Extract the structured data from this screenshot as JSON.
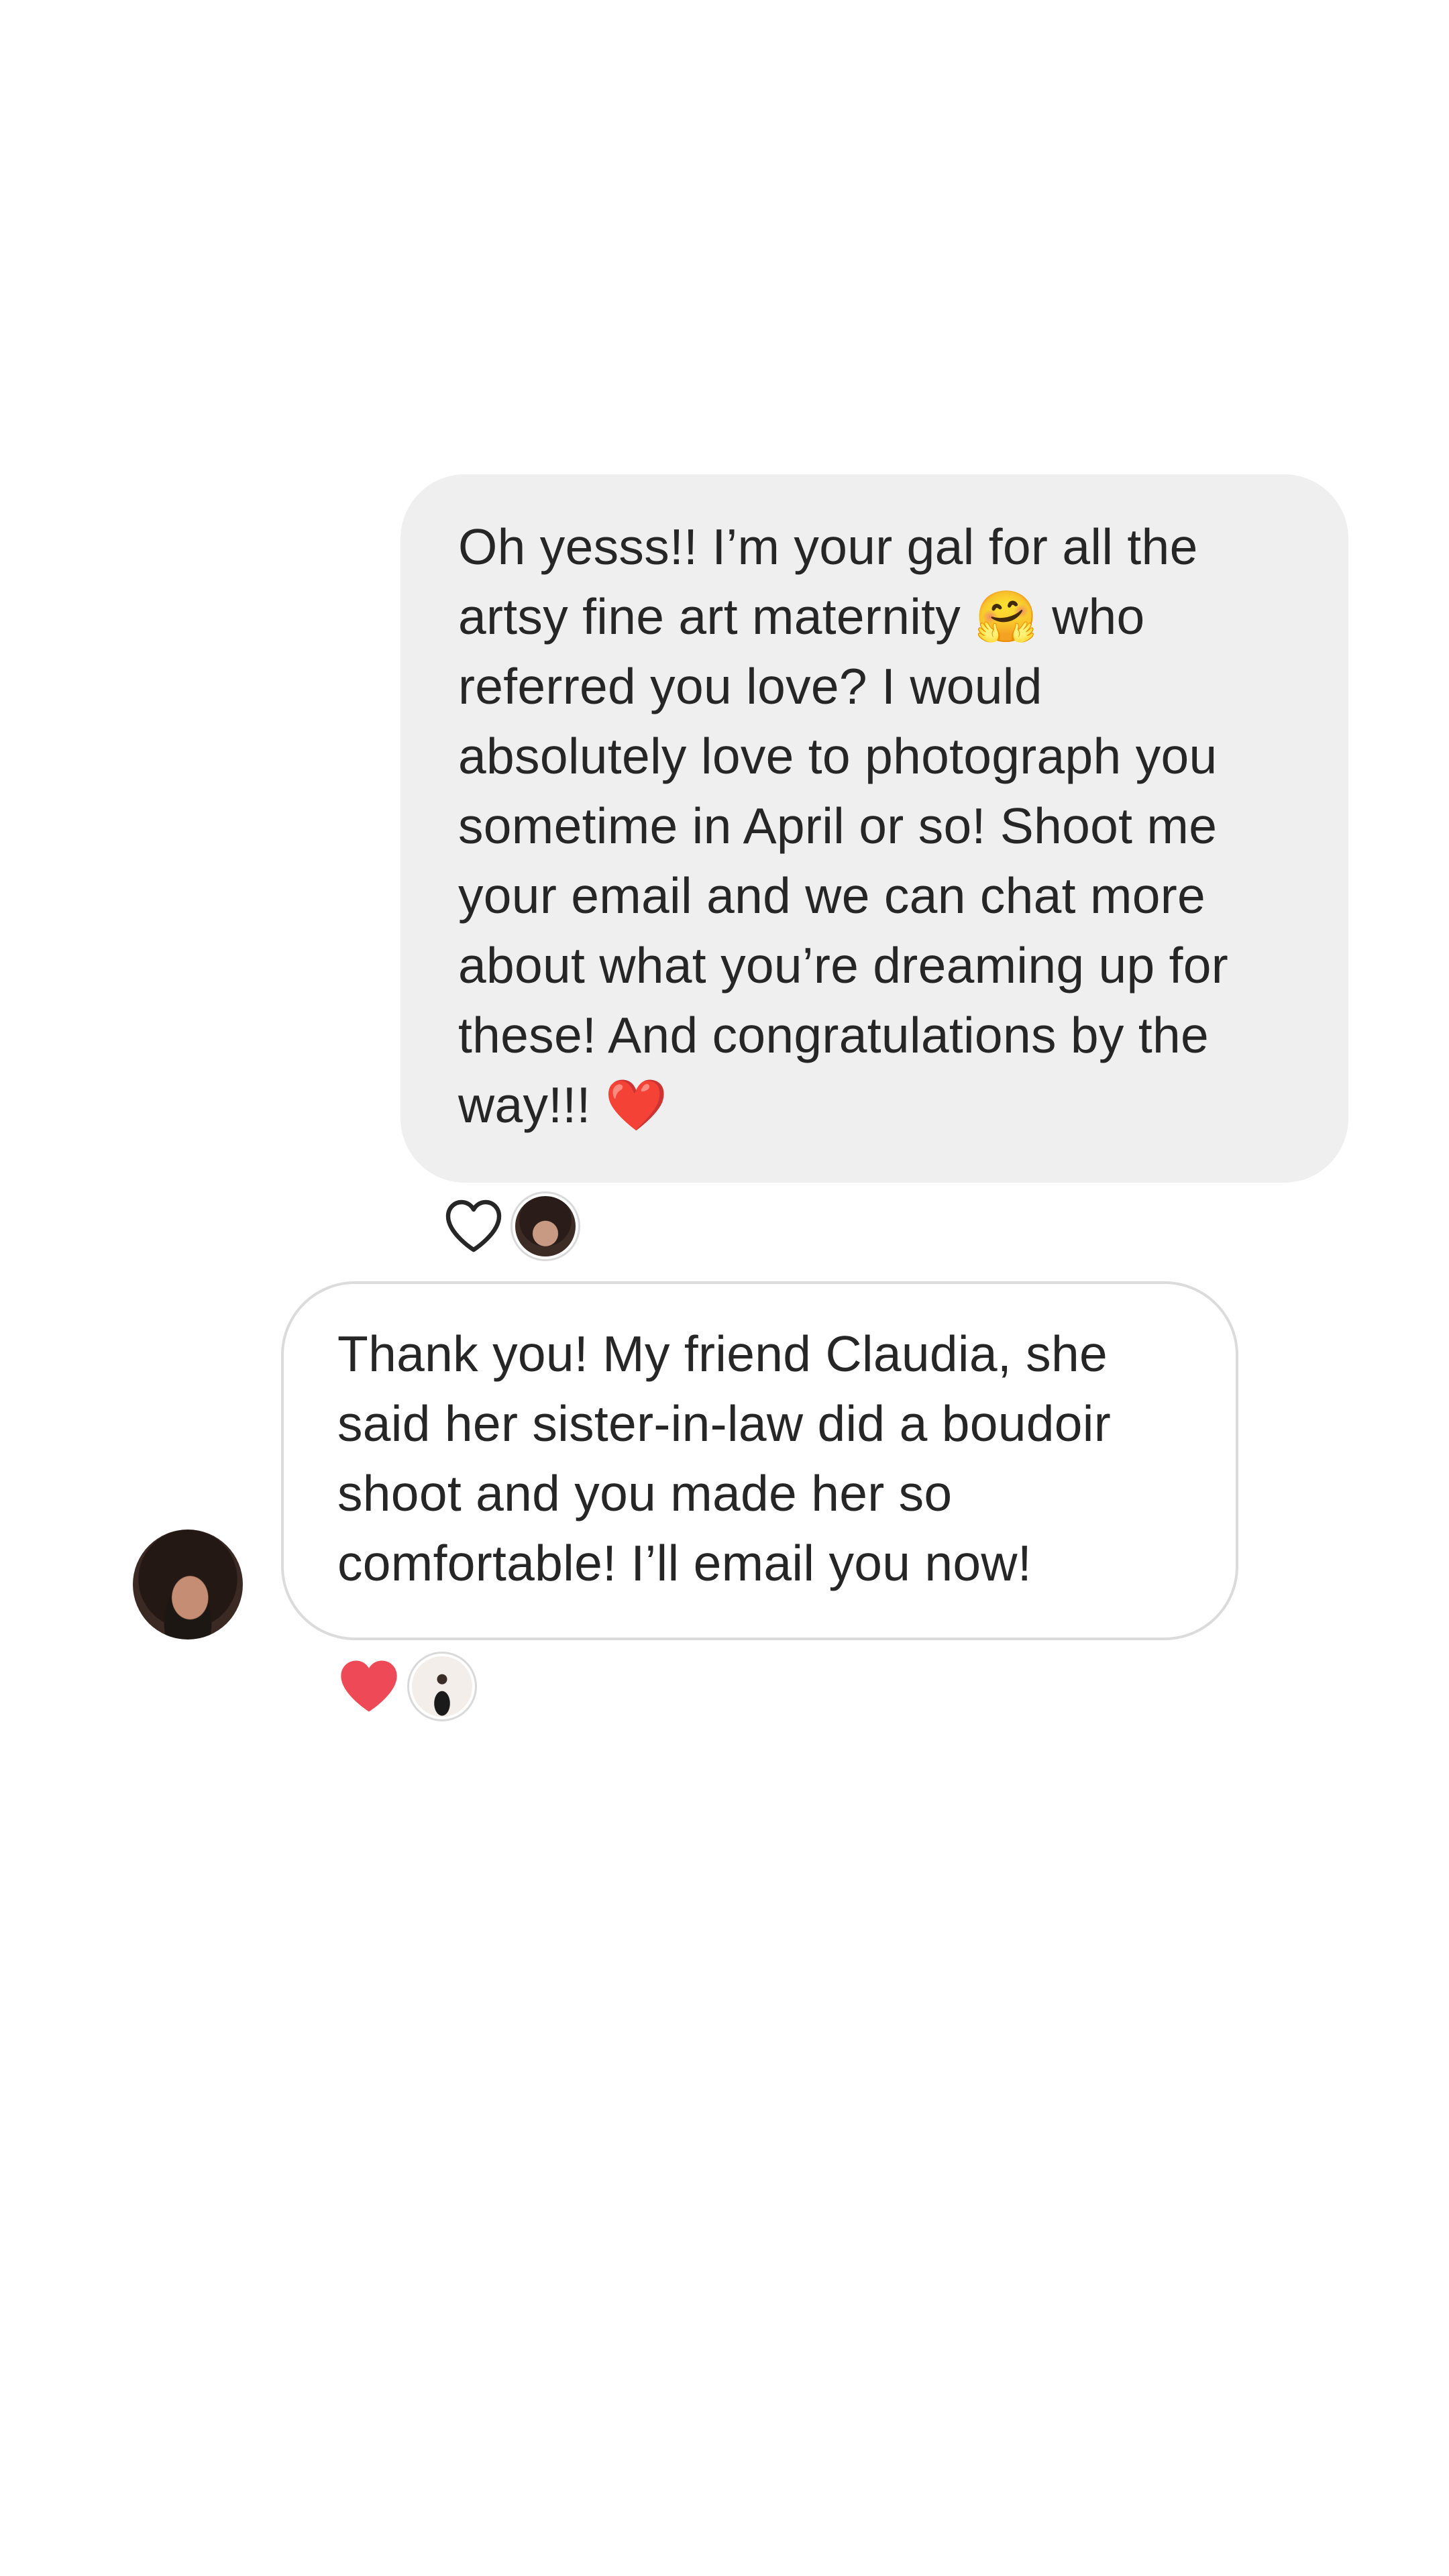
{
  "messages": [
    {
      "direction": "outgoing",
      "text": "Oh yesss!! I’m your gal for all the\nartsy fine art maternity 🤗 who\nreferred you love? I would\nabsolutely love to photograph you\nsometime in April or so! Shoot me\nyour email and we can chat more\nabout what you’re dreaming up for\nthese! And congratulations by the\nway!!! ❤️",
      "reaction": {
        "icon": "heart-outline-icon"
      }
    },
    {
      "direction": "incoming",
      "text": "Thank you! My friend Claudia, she\nsaid her sister-in-law did a boudoir\nshoot and you made her so\ncomfortable! I’ll email you now!",
      "reaction": {
        "icon": "heart-filled-icon",
        "color": "#ed4956"
      }
    }
  ],
  "colors": {
    "outgoing_bubble": "#efefef",
    "incoming_border": "#dbdbdb",
    "text": "#262626",
    "like_heart": "#ed4956"
  }
}
